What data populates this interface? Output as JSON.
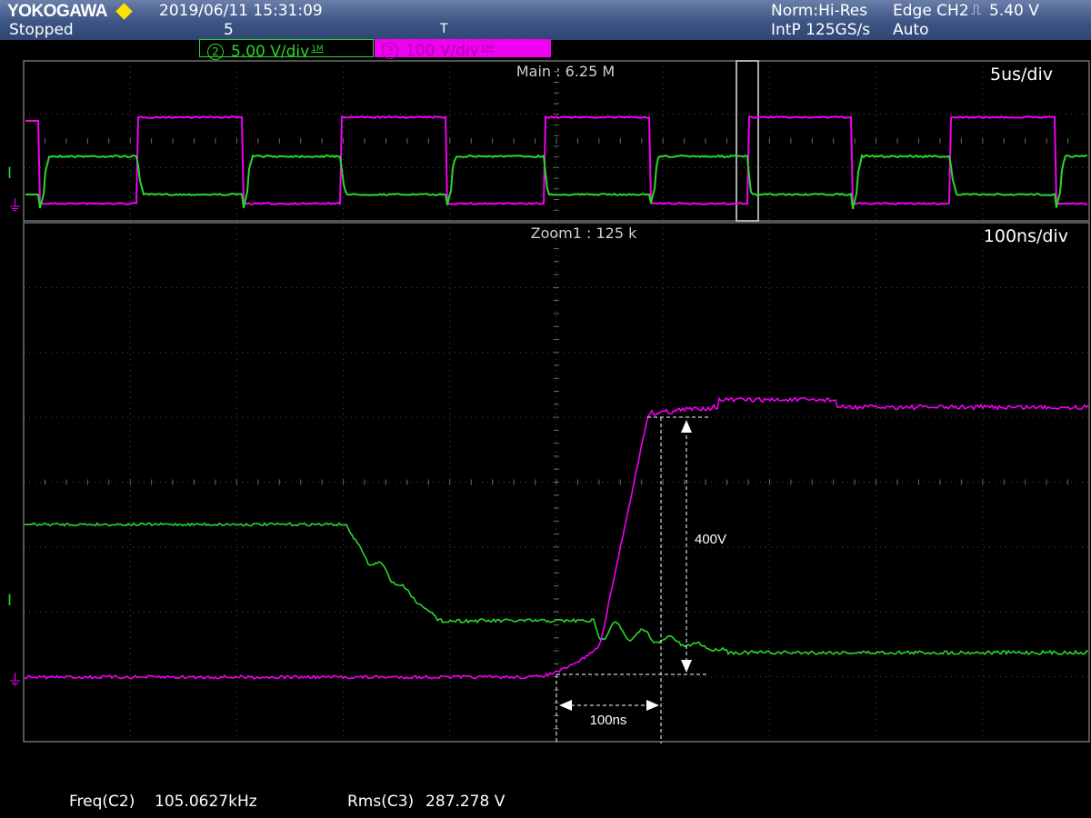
{
  "header": {
    "brand": "YOKOGAWA",
    "datetime": "2019/06/11 15:31:09",
    "status": "Stopped",
    "acq_count": "5",
    "acq_mode": "Norm:Hi-Res",
    "sample_rate": "IntP 125GS/s",
    "trigger_type": "Edge CH2",
    "trigger_level": "5.40 V",
    "trigger_mode": "Auto",
    "trigger_pos_marker": "T"
  },
  "channels": [
    {
      "num": "2",
      "scale": "5.00 V/div",
      "suffix": "1M",
      "color": "#2bd62b"
    },
    {
      "num": "3",
      "scale": "100 V/div",
      "suffix": "1M",
      "color": "#f000f0"
    }
  ],
  "main_window": {
    "label": "Main : 6.25 M",
    "timebase": "5us/div"
  },
  "zoom_window": {
    "label": "Zoom1 : 125 k",
    "timebase": "100ns/div"
  },
  "markers": {
    "level": "I",
    "ground": "⏚"
  },
  "annotations": {
    "voltage": "400V",
    "time": "100ns"
  },
  "measurements": [
    {
      "label": "Freq(C2)",
      "value": "105.0627kHz"
    },
    {
      "label": "Rms(C3)",
      "value": "287.278 V"
    }
  ],
  "colors": {
    "ch2": "#2bd62b",
    "ch3": "#f000f0",
    "grid": "#5a5a5a",
    "header": "#3d5585"
  }
}
